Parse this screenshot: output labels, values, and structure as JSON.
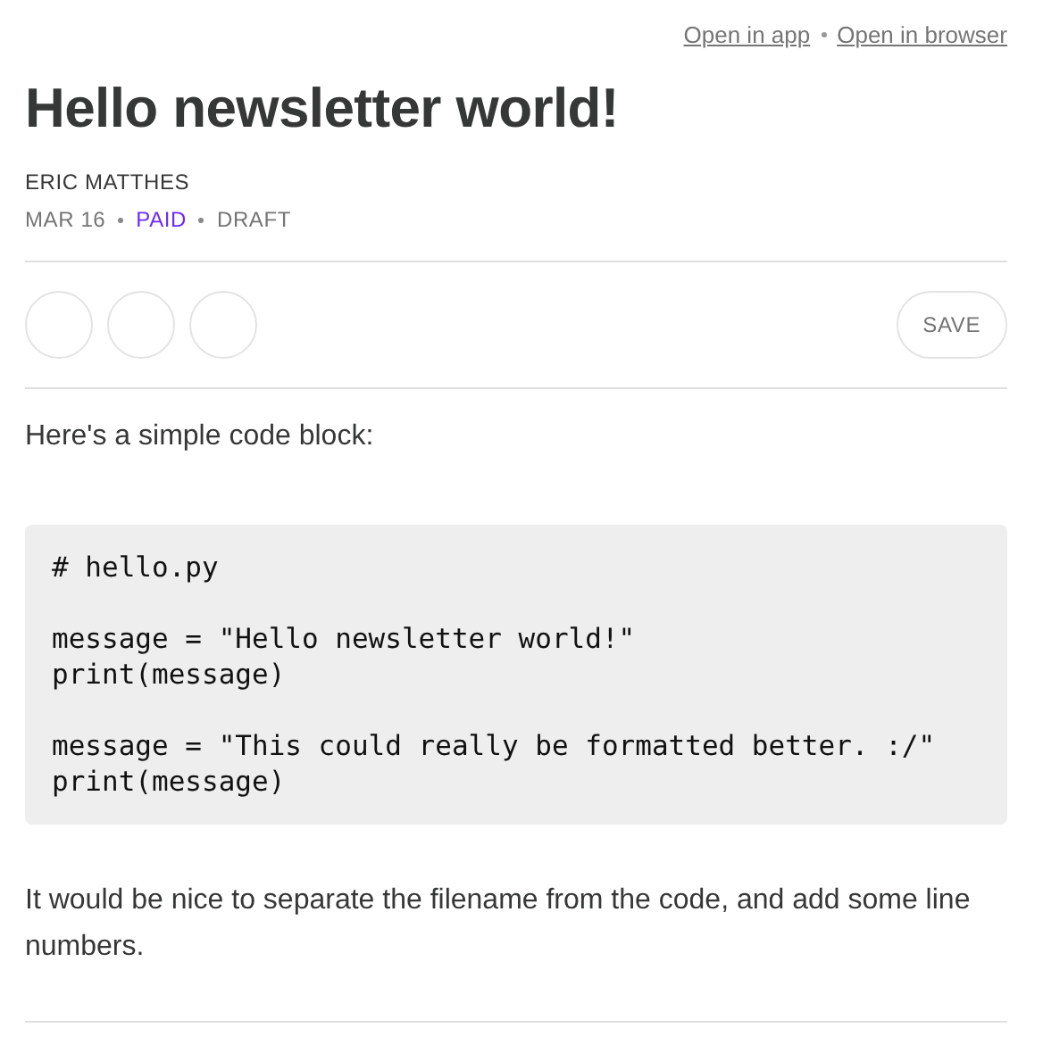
{
  "top_links": [
    {
      "label": "Open in app"
    },
    {
      "label": "Open in browser"
    }
  ],
  "title": "Hello newsletter world!",
  "author": "ERIC MATTHES",
  "meta": [
    {
      "text": "MAR 16",
      "color": "#757575"
    },
    {
      "text": "PAID",
      "color": "#6b2bff"
    },
    {
      "text": "DRAFT",
      "color": "#757575"
    }
  ],
  "actions": {
    "buttons": [
      {
        "kind": "circle"
      },
      {
        "kind": "circle"
      },
      {
        "kind": "circle"
      }
    ],
    "save": "SAVE"
  },
  "body": [
    {
      "kind": "paragraph",
      "text": "Here's a simple code block:"
    },
    {
      "kind": "code",
      "text": "# hello.py\n\nmessage = \"Hello newsletter world!\"\nprint(message)\n\nmessage = \"This could really be formatted better. :/\"\nprint(message)"
    },
    {
      "kind": "paragraph",
      "text": "It would be nice to separate the filename from the code, and add some line numbers."
    }
  ]
}
